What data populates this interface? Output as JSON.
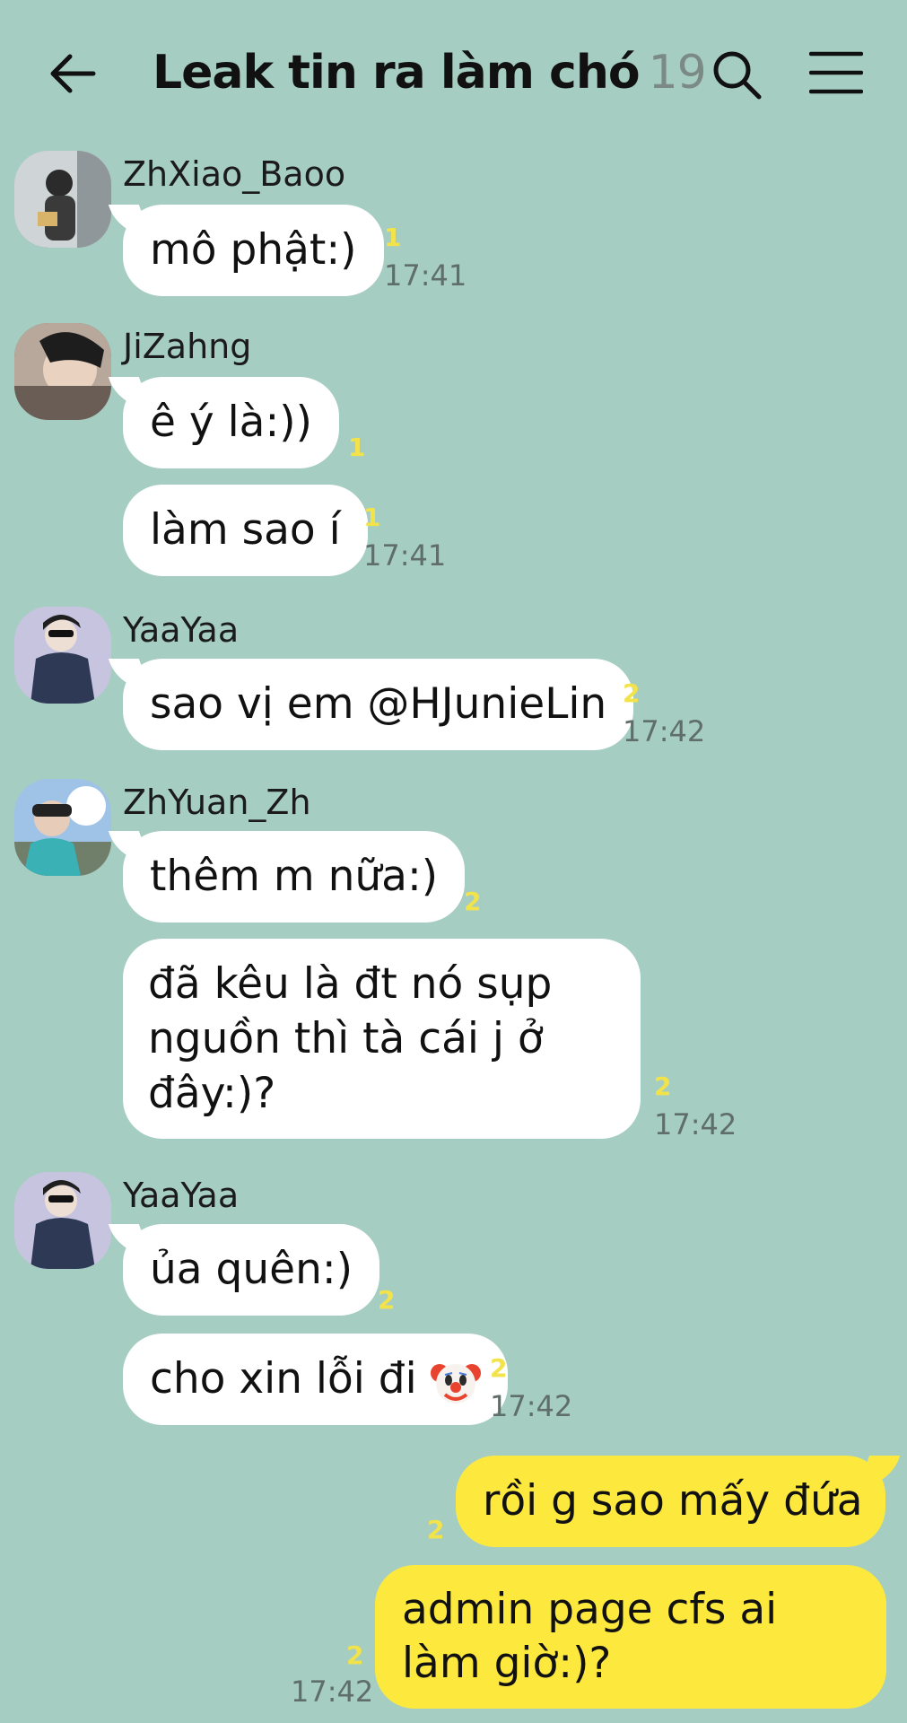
{
  "header": {
    "title": "Leak tin ra làm chó",
    "member_count": "19"
  },
  "colors": {
    "background": "#a6cdc1",
    "my_bubble": "#fde93d",
    "other_bubble": "#ffffff",
    "unread": "#f3e34a"
  },
  "messages": [
    {
      "sender": "ZhXiao_Baoo",
      "text": "mô phật:)",
      "unread": "1",
      "time": "17:41"
    },
    {
      "sender": "JiZahng",
      "text": "ê ý là:))",
      "unread": "1"
    },
    {
      "text": "làm sao í",
      "unread": "1",
      "time": "17:41"
    },
    {
      "sender": "YaaYaa",
      "text": "sao vị em @HJunieLin",
      "unread": "2",
      "time": "17:42"
    },
    {
      "sender": "ZhYuan_Zh",
      "text": "thêm m nữa:)",
      "unread": "2"
    },
    {
      "text": "đã kêu là đt nó sụp nguồn thì tà cái j ở đây:)?",
      "unread": "2",
      "time": "17:42"
    },
    {
      "sender": "YaaYaa",
      "text": "ủa quên:)",
      "unread": "2"
    },
    {
      "text": "cho xin lỗi đi",
      "emoji": "clown-face",
      "unread": "2",
      "time": "17:42"
    },
    {
      "mine": true,
      "text": "rồi g sao mấy đứa",
      "unread": "2"
    },
    {
      "mine": true,
      "text": "admin page cfs ai làm giờ:)?",
      "unread": "2",
      "time": "17:42"
    }
  ]
}
